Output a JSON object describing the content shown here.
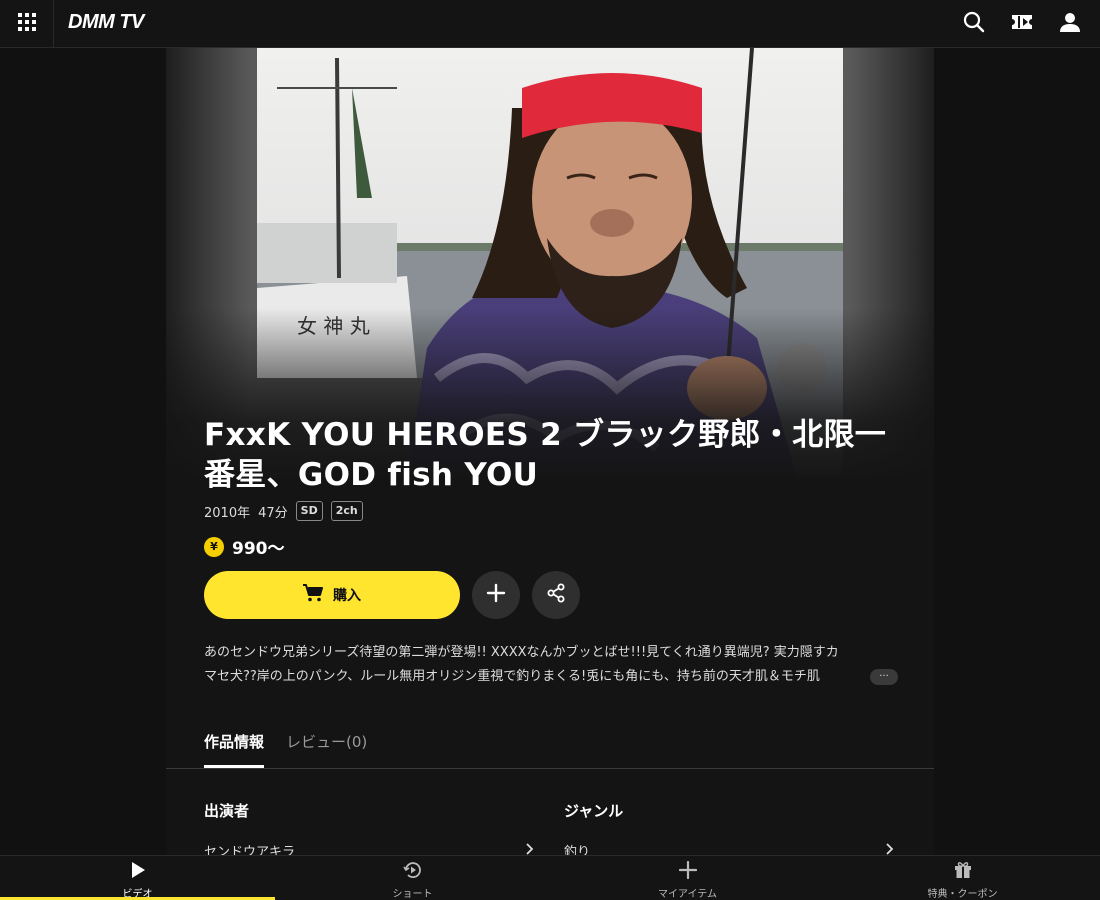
{
  "header": {
    "logo": "DMM TV",
    "menu_icon": "grid-menu-icon",
    "icons": [
      "search-icon",
      "ticket-icon",
      "user-icon"
    ]
  },
  "hero": {
    "image": "fisherman-red-headband-photo"
  },
  "video": {
    "title": "FxxK YOU HEROES 2 ブラック野郎・北限一番星、GOD fish YOU",
    "year": "2010年",
    "duration": "47分",
    "badges": [
      "SD",
      "2ch"
    ],
    "price_symbol": "¥",
    "price": "990〜",
    "buy_label": "購入",
    "description_line1": "あのセンドウ兄弟シリーズ待望の第二弾が登場!! XXXXなんかブッとばせ!!!見てくれ通り異端児? 実力隠すカ",
    "description_line2": "マセ犬??岸の上のパンク、ルール無用オリジン重視で釣りまくる!兎にも角にも、持ち前の天才肌＆モチ肌",
    "more_label": "···"
  },
  "tabs": [
    {
      "label": "作品情報",
      "active": true
    },
    {
      "label": "レビュー(0)",
      "active": false
    }
  ],
  "sections": {
    "cast": {
      "heading": "出演者",
      "item": "センドウアキラ"
    },
    "genre": {
      "heading": "ジャンル",
      "item": "釣り"
    }
  },
  "bottom_nav": [
    {
      "label": "ビデオ",
      "icon": "play-icon",
      "active": true
    },
    {
      "label": "ショート",
      "icon": "short-play-icon",
      "active": false
    },
    {
      "label": "マイアイテム",
      "icon": "plus-icon",
      "active": false
    },
    {
      "label": "特典・クーポン",
      "icon": "gift-icon",
      "active": false
    }
  ],
  "colors": {
    "accent": "#ffe52e",
    "background": "#111111",
    "surface": "#141414"
  }
}
